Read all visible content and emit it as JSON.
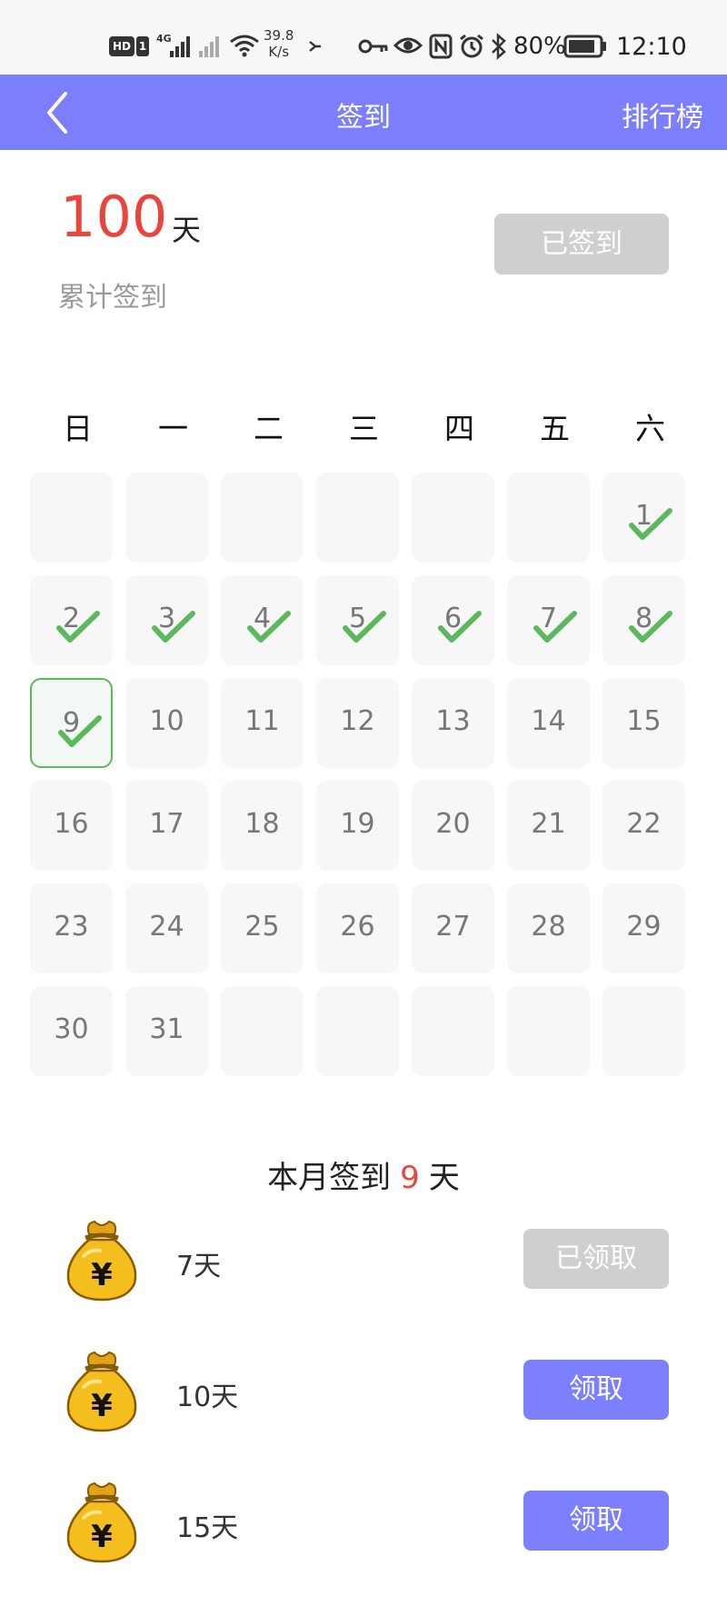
{
  "status_bar": {
    "hd": "HD",
    "sim": "1",
    "network": "4G",
    "speed_value": "39.8",
    "speed_unit": "K/s",
    "battery": "80%",
    "time": "12:10",
    "icons": [
      "signal-icon",
      "wifi-icon",
      "key-icon",
      "eye-icon",
      "nfc-icon",
      "alarm-icon",
      "bluetooth-icon",
      "battery-icon"
    ]
  },
  "header": {
    "title": "签到",
    "ranking": "排行榜"
  },
  "summary": {
    "total_days": "100",
    "unit": "天",
    "label": "累计签到",
    "signed_button": "已签到"
  },
  "calendar": {
    "weekdays": [
      "日",
      "一",
      "二",
      "三",
      "四",
      "五",
      "六"
    ],
    "first_weekday_index": 6,
    "days_in_month": 31,
    "today": 9,
    "checked_days": [
      1,
      2,
      3,
      4,
      5,
      6,
      7,
      8,
      9
    ]
  },
  "month": {
    "prefix": "本月签到",
    "count": "9",
    "unit": "天"
  },
  "rewards": [
    {
      "label": "7天",
      "button": "已领取",
      "state": "claimed"
    },
    {
      "label": "10天",
      "button": "领取",
      "state": "active"
    },
    {
      "label": "15天",
      "button": "领取",
      "state": "active"
    }
  ],
  "colors": {
    "accent": "#7b7ffb",
    "highlight_red": "#e8453c",
    "check_green": "#5cb85c",
    "disabled_gray": "#cfcfcf"
  }
}
